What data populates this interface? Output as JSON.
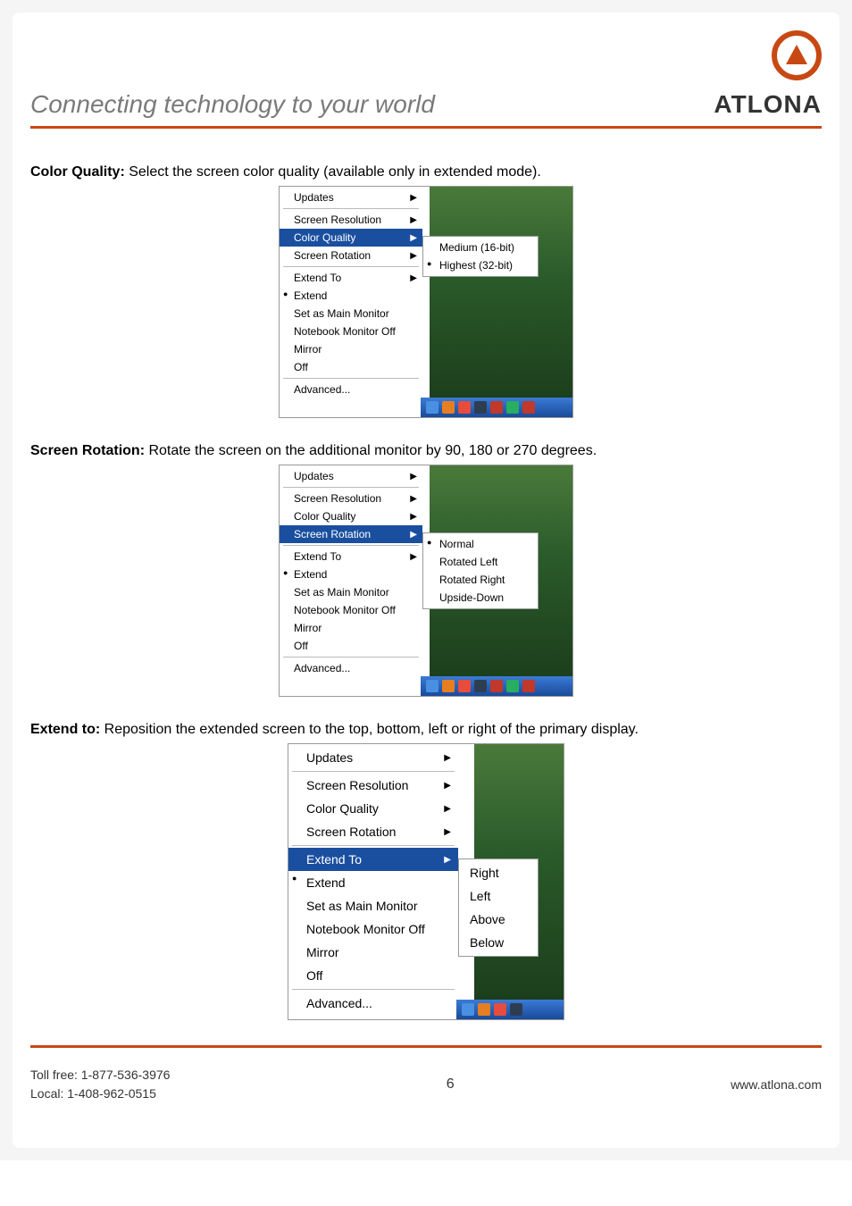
{
  "header": {
    "tagline": "Connecting technology to your world",
    "brand": "ATLONA"
  },
  "sections": [
    {
      "title": "Color Quality:",
      "desc": "Select the screen color quality (available only in extended mode)."
    },
    {
      "title": "Screen Rotation:",
      "desc": "Rotate the screen on the additional monitor by 90, 180 or 270 degrees."
    },
    {
      "title": "Extend to:",
      "desc": "Reposition the extended screen to the top, bottom, left or right of the primary display."
    }
  ],
  "menu": {
    "updates": "Updates",
    "screen_resolution": "Screen Resolution",
    "color_quality": "Color Quality",
    "screen_rotation": "Screen Rotation",
    "extend_to": "Extend To",
    "extend": "Extend",
    "set_main": "Set as Main Monitor",
    "notebook_off": "Notebook Monitor Off",
    "mirror": "Mirror",
    "off": "Off",
    "advanced": "Advanced..."
  },
  "sub_color": {
    "medium": "Medium (16-bit)",
    "highest": "Highest (32-bit)"
  },
  "sub_rotation": {
    "normal": "Normal",
    "left": "Rotated Left",
    "right": "Rotated Right",
    "upside": "Upside-Down"
  },
  "sub_extend": {
    "right": "Right",
    "left": "Left",
    "above": "Above",
    "below": "Below"
  },
  "footer": {
    "toll_free": "Toll free: 1-877-536-3976",
    "local": "Local: 1-408-962-0515",
    "page": "6",
    "url": "www.atlona.com"
  }
}
